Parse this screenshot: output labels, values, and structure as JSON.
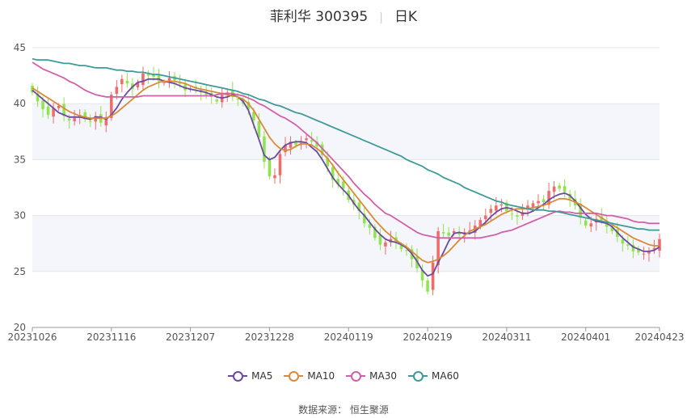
{
  "title": {
    "name": "菲利华 300395",
    "period": "日K"
  },
  "source": "数据来源： 恒生聚源",
  "colors": {
    "up": "#f06c6c",
    "down": "#90e44f",
    "ma5": "#6a4aa0",
    "ma10": "#d9893a",
    "ma30": "#d060a8",
    "ma60": "#3f9a9a",
    "band": "#f4f6fb",
    "grid": "#e6e6e6"
  },
  "chart_data": {
    "type": "candlestick",
    "ylim": [
      20,
      45
    ],
    "yticks": [
      "20",
      "25",
      "30",
      "35",
      "40",
      "45"
    ],
    "ytick_values": [
      20,
      25,
      30,
      35,
      40,
      45
    ],
    "xtick_labels": [
      "20231026",
      "20231116",
      "20231207",
      "20231228",
      "20240119",
      "20240219",
      "20240311",
      "20240401",
      "20240423"
    ],
    "xtick_index": [
      0,
      15,
      30,
      45,
      60,
      75,
      90,
      105,
      119
    ],
    "legend": [
      "MA5",
      "MA10",
      "MA30",
      "MA60"
    ],
    "candles_close": [
      41.0,
      40.2,
      39.5,
      39.0,
      39.6,
      39.8,
      38.9,
      38.5,
      38.7,
      39.0,
      38.6,
      38.4,
      38.9,
      38.3,
      38.8,
      40.8,
      41.5,
      42.2,
      41.8,
      41.3,
      41.9,
      42.7,
      42.5,
      42.4,
      42.0,
      41.9,
      42.3,
      42.1,
      41.8,
      41.2,
      41.3,
      41.4,
      41.0,
      40.8,
      40.6,
      40.2,
      40.8,
      41.0,
      40.6,
      40.4,
      40.0,
      39.5,
      38.5,
      37.0,
      34.8,
      33.5,
      33.6,
      35.5,
      36.3,
      36.6,
      36.3,
      36.5,
      36.9,
      36.6,
      36.2,
      35.4,
      34.4,
      33.2,
      32.8,
      32.4,
      31.4,
      31.0,
      30.4,
      29.3,
      28.9,
      28.0,
      27.4,
      27.6,
      27.9,
      27.6,
      27.0,
      26.9,
      26.1,
      25.3,
      24.2,
      23.2,
      25.8,
      28.6,
      28.4,
      28.2,
      28.6,
      28.3,
      28.5,
      28.7,
      29.1,
      29.6,
      30.0,
      30.6,
      30.9,
      31.0,
      30.4,
      30.1,
      29.9,
      30.3,
      30.9,
      31.1,
      31.3,
      31.2,
      32.2,
      32.6,
      32.4,
      32.1,
      31.5,
      30.9,
      29.8,
      29.1,
      29.3,
      29.7,
      29.6,
      29.0,
      28.6,
      28.1,
      27.5,
      27.3,
      26.8,
      26.7,
      26.6,
      26.8,
      27.1,
      27.9
    ],
    "series": [
      {
        "name": "MA5",
        "values": [
          41.2,
          40.8,
          40.4,
          40.0,
          39.6,
          39.2,
          39.0,
          38.8,
          38.8,
          38.8,
          38.7,
          38.6,
          38.8,
          38.8,
          38.6,
          39.0,
          39.6,
          40.4,
          41.0,
          41.5,
          41.9,
          42.0,
          42.2,
          42.2,
          42.2,
          42.0,
          41.9,
          41.8,
          41.6,
          41.4,
          41.3,
          41.2,
          41.1,
          41.0,
          40.8,
          40.6,
          40.5,
          40.6,
          40.8,
          40.6,
          40.2,
          39.4,
          38.1,
          36.8,
          35.4,
          35.0,
          35.2,
          35.8,
          36.3,
          36.5,
          36.6,
          36.6,
          36.5,
          36.1,
          35.7,
          35.0,
          34.2,
          33.4,
          32.8,
          32.3,
          31.8,
          31.1,
          30.5,
          30.0,
          29.4,
          28.8,
          28.3,
          27.9,
          27.7,
          27.6,
          27.4,
          27.1,
          26.6,
          25.9,
          25.1,
          24.6,
          24.8,
          25.8,
          26.7,
          27.7,
          28.4,
          28.5,
          28.4,
          28.4,
          28.6,
          29.0,
          29.4,
          29.9,
          30.3,
          30.6,
          30.7,
          30.6,
          30.4,
          30.2,
          30.2,
          30.4,
          30.7,
          31.0,
          31.4,
          31.7,
          31.9,
          32.0,
          31.8,
          31.3,
          30.7,
          30.1,
          29.7,
          29.5,
          29.4,
          29.3,
          29.0,
          28.5,
          28.0,
          27.6,
          27.2,
          27.0,
          26.8,
          26.8,
          26.9,
          27.2
        ]
      },
      {
        "name": "MA10",
        "values": [
          41.4,
          41.1,
          40.8,
          40.5,
          40.2,
          39.9,
          39.6,
          39.3,
          39.1,
          38.9,
          38.8,
          38.7,
          38.7,
          38.7,
          38.7,
          38.9,
          39.2,
          39.6,
          40.0,
          40.4,
          40.8,
          41.2,
          41.5,
          41.7,
          41.9,
          42.0,
          42.0,
          42.0,
          41.9,
          41.8,
          41.6,
          41.4,
          41.3,
          41.2,
          41.1,
          41.0,
          40.9,
          40.8,
          40.7,
          40.6,
          40.4,
          40.0,
          39.4,
          38.6,
          37.8,
          37.0,
          36.4,
          36.0,
          35.8,
          35.9,
          36.2,
          36.4,
          36.4,
          36.3,
          36.0,
          35.6,
          35.1,
          34.5,
          33.8,
          33.2,
          32.6,
          32.0,
          31.4,
          30.8,
          30.2,
          29.6,
          29.1,
          28.6,
          28.2,
          27.8,
          27.5,
          27.2,
          26.8,
          26.4,
          26.0,
          25.8,
          25.9,
          26.1,
          26.4,
          26.8,
          27.3,
          27.8,
          28.2,
          28.6,
          28.8,
          29.0,
          29.2,
          29.5,
          29.8,
          30.1,
          30.3,
          30.5,
          30.6,
          30.6,
          30.6,
          30.7,
          30.8,
          30.9,
          31.1,
          31.3,
          31.5,
          31.5,
          31.4,
          31.2,
          31.0,
          30.7,
          30.4,
          30.1,
          29.8,
          29.5,
          29.2,
          28.9,
          28.6,
          28.3,
          28.0,
          27.8,
          27.6,
          27.4,
          27.3,
          27.3
        ]
      },
      {
        "name": "MA30",
        "values": [
          43.7,
          43.4,
          43.1,
          42.9,
          42.7,
          42.5,
          42.3,
          42.0,
          41.8,
          41.5,
          41.2,
          41.0,
          40.8,
          40.7,
          40.6,
          40.6,
          40.6,
          40.6,
          40.6,
          40.6,
          40.6,
          40.7,
          40.7,
          40.7,
          40.7,
          40.7,
          40.7,
          40.7,
          40.7,
          40.7,
          40.7,
          40.7,
          40.7,
          40.7,
          40.7,
          40.8,
          40.9,
          40.9,
          40.9,
          40.8,
          40.7,
          40.5,
          40.3,
          40.0,
          39.8,
          39.5,
          39.2,
          38.9,
          38.7,
          38.4,
          38.1,
          37.7,
          37.3,
          36.9,
          36.5,
          36.0,
          35.5,
          35.0,
          34.5,
          34.0,
          33.5,
          32.9,
          32.4,
          31.9,
          31.5,
          31.0,
          30.6,
          30.2,
          30.0,
          29.7,
          29.4,
          29.1,
          28.8,
          28.5,
          28.3,
          28.2,
          28.1,
          28.0,
          28.0,
          28.0,
          28.0,
          28.0,
          28.0,
          28.0,
          28.0,
          28.0,
          28.1,
          28.2,
          28.3,
          28.5,
          28.6,
          28.7,
          28.9,
          29.1,
          29.3,
          29.5,
          29.7,
          29.9,
          30.1,
          30.3,
          30.4,
          30.3,
          30.3,
          30.2,
          30.2,
          30.2,
          30.2,
          30.2,
          30.1,
          30.0,
          30.0,
          29.9,
          29.8,
          29.7,
          29.5,
          29.4,
          29.4,
          29.3,
          29.3,
          29.3
        ]
      },
      {
        "name": "MA60",
        "values": [
          44.0,
          43.9,
          43.9,
          43.9,
          43.8,
          43.7,
          43.6,
          43.6,
          43.5,
          43.4,
          43.4,
          43.3,
          43.2,
          43.2,
          43.2,
          43.1,
          43.0,
          43.0,
          42.9,
          42.9,
          42.8,
          42.8,
          42.7,
          42.6,
          42.6,
          42.5,
          42.4,
          42.3,
          42.2,
          42.1,
          42.0,
          41.9,
          41.8,
          41.7,
          41.6,
          41.5,
          41.4,
          41.3,
          41.2,
          41.1,
          40.9,
          40.8,
          40.6,
          40.4,
          40.3,
          40.1,
          39.9,
          39.8,
          39.6,
          39.4,
          39.2,
          39.1,
          38.9,
          38.7,
          38.5,
          38.3,
          38.1,
          37.9,
          37.7,
          37.5,
          37.3,
          37.1,
          36.9,
          36.7,
          36.5,
          36.3,
          36.1,
          35.9,
          35.7,
          35.5,
          35.3,
          35.0,
          34.8,
          34.6,
          34.4,
          34.1,
          33.9,
          33.7,
          33.4,
          33.2,
          33.0,
          32.8,
          32.5,
          32.3,
          32.1,
          31.9,
          31.7,
          31.5,
          31.3,
          31.2,
          31.0,
          30.9,
          30.8,
          30.7,
          30.6,
          30.5,
          30.5,
          30.5,
          30.4,
          30.4,
          30.3,
          30.2,
          30.1,
          30.0,
          29.9,
          29.8,
          29.7,
          29.6,
          29.5,
          29.4,
          29.3,
          29.2,
          29.1,
          29.0,
          28.9,
          28.8,
          28.8,
          28.7,
          28.7,
          28.7
        ]
      }
    ]
  }
}
